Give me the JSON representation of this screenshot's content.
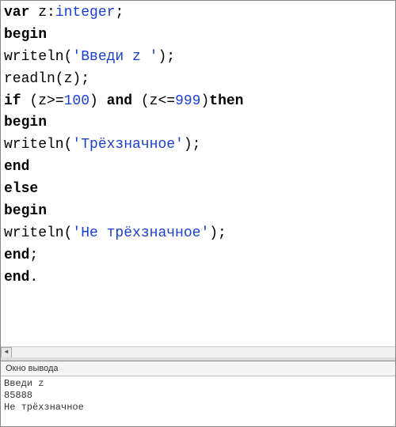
{
  "code": {
    "lines": [
      {
        "tokens": [
          {
            "t": "var",
            "c": "kw"
          },
          {
            "t": " z:",
            "c": ""
          },
          {
            "t": "integer",
            "c": "type"
          },
          {
            "t": ";",
            "c": ""
          }
        ]
      },
      {
        "tokens": [
          {
            "t": "begin",
            "c": "kw"
          }
        ]
      },
      {
        "tokens": [
          {
            "t": "writeln(",
            "c": ""
          },
          {
            "t": "'Введи z '",
            "c": "str"
          },
          {
            "t": ");",
            "c": ""
          }
        ]
      },
      {
        "tokens": [
          {
            "t": "readln(z);",
            "c": ""
          }
        ]
      },
      {
        "tokens": [
          {
            "t": "if",
            "c": "kw"
          },
          {
            "t": " (z>=",
            "c": ""
          },
          {
            "t": "100",
            "c": "num"
          },
          {
            "t": ") ",
            "c": ""
          },
          {
            "t": "and",
            "c": "kw"
          },
          {
            "t": " (z<=",
            "c": ""
          },
          {
            "t": "999",
            "c": "num"
          },
          {
            "t": ")",
            "c": ""
          },
          {
            "t": "then",
            "c": "kw"
          }
        ]
      },
      {
        "tokens": [
          {
            "t": "begin",
            "c": "kw"
          }
        ]
      },
      {
        "tokens": [
          {
            "t": "writeln(",
            "c": ""
          },
          {
            "t": "'Трёхзначное'",
            "c": "str"
          },
          {
            "t": ");",
            "c": ""
          }
        ]
      },
      {
        "tokens": [
          {
            "t": "end",
            "c": "kw"
          }
        ]
      },
      {
        "tokens": [
          {
            "t": "else",
            "c": "kw"
          }
        ]
      },
      {
        "tokens": [
          {
            "t": "begin",
            "c": "kw"
          }
        ]
      },
      {
        "tokens": [
          {
            "t": "writeln(",
            "c": ""
          },
          {
            "t": "'Не трёхзначное'",
            "c": "str"
          },
          {
            "t": ");",
            "c": ""
          }
        ]
      },
      {
        "tokens": [
          {
            "t": "end",
            "c": "kw"
          },
          {
            "t": ";",
            "c": ""
          }
        ]
      },
      {
        "tokens": [
          {
            "t": "end",
            "c": "kw"
          },
          {
            "t": ".",
            "c": ""
          }
        ]
      }
    ]
  },
  "output": {
    "title": "Окно вывода",
    "lines": [
      "Введи z ",
      "85888",
      "Не трёхзначное"
    ]
  },
  "scroll": {
    "left_arrow": "◄"
  }
}
